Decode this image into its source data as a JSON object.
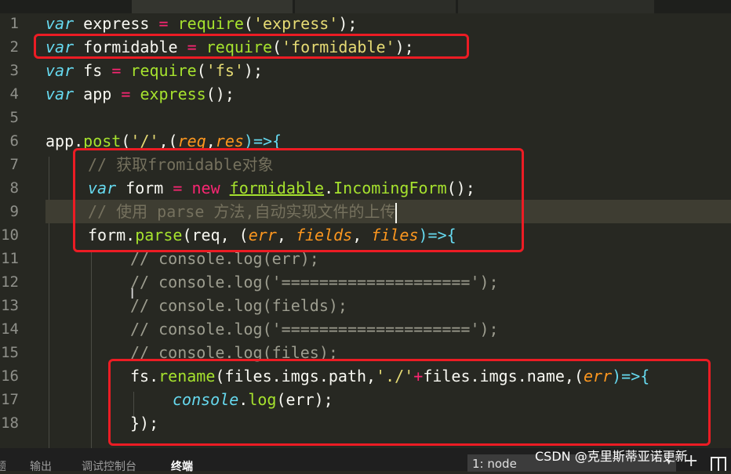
{
  "editor": {
    "line_numbers": [
      "1",
      "2",
      "3",
      "4",
      "5",
      "6",
      "7",
      "8",
      "9",
      "10",
      "11",
      "12",
      "13",
      "14",
      "15",
      "16",
      "17",
      "18"
    ],
    "code": {
      "l1": {
        "kw": "var",
        "name": "express",
        "eq": "=",
        "fn": "require",
        "open": "(",
        "str": "'express'",
        "close": ");"
      },
      "l2": {
        "kw": "var",
        "name": "formidable",
        "eq": "=",
        "fn": "require",
        "open": "(",
        "str": "'formidable'",
        "close": ");"
      },
      "l3": {
        "kw": "var",
        "name": "fs",
        "eq": "=",
        "fn": "require",
        "open": "(",
        "str": "'fs'",
        "close": ");"
      },
      "l4": {
        "kw": "var",
        "name": "app",
        "eq": "=",
        "fn": "express",
        "close": "();"
      },
      "l6": {
        "obj": "app",
        "dot": ".",
        "fn": "post",
        "open": "(",
        "str": "'/'",
        "comma": ",(",
        "p1": "req",
        "sep": ",",
        "p2": "res",
        "arrow": ")=>{"
      },
      "l7": {
        "comment": "// 获取fromidable对象"
      },
      "l8": {
        "kw": "var",
        "name": "form",
        "eq": "=",
        "new": "new",
        "cls": "formidable",
        "dot": ".",
        "ctor": "IncomingForm",
        "close": "();"
      },
      "l9": {
        "comment": "// 使用 parse 方法,自动实现文件的上传"
      },
      "l10": {
        "obj": "form",
        "dot": ".",
        "fn": "parse",
        "open": "(req, (",
        "p1": "err",
        "sep1": ", ",
        "p2": "fields",
        "sep2": ", ",
        "p3": "files",
        "arrow": ")=>{"
      },
      "l11": {
        "comment": "// console.log(err);"
      },
      "l12": {
        "comment": "// console.log('====================');"
      },
      "l13": {
        "comment": "// console.log(fields);"
      },
      "l14": {
        "comment": "// console.log('====================');"
      },
      "l15": {
        "comment": "// console.log(files);"
      },
      "l16": {
        "obj": "fs",
        "dot": ".",
        "fn": "rename",
        "a": "(files.imgs.path,",
        "str": "'./'",
        "plus": "+",
        "b": "files.imgs.name,(",
        "p1": "err",
        "arrow": ")=>{"
      },
      "l17": {
        "obj": "console",
        "dot": ".",
        "fn": "log",
        "rest": "(err);"
      },
      "l18": {
        "text": "});"
      }
    }
  },
  "panel": {
    "tabs": [
      {
        "label": "题"
      },
      {
        "label": "输出"
      },
      {
        "label": "调试控制台"
      },
      {
        "label": "终端"
      }
    ],
    "terminal_selector": "1: node",
    "watermark": "CSDN @克里斯蒂亚诺更新"
  },
  "colors": {
    "background": "#272822",
    "keyword_italic": "#66d9ef",
    "operator": "#f92672",
    "string": "#e6db74",
    "function": "#a6e22e",
    "parameter": "#fd971f",
    "comment": "#75715e",
    "annotation_box": "#ec1c24"
  },
  "icons": [
    "add-terminal-icon",
    "split-terminal-icon",
    "chevron-down-icon",
    "text-cursor-icon"
  ]
}
